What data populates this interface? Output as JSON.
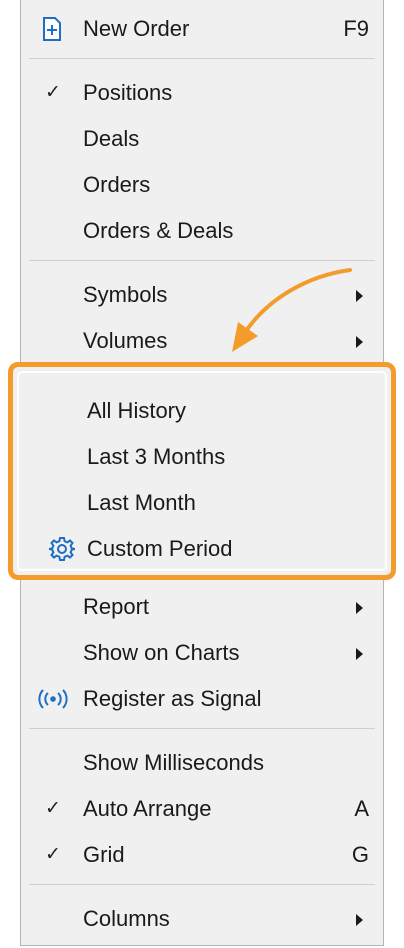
{
  "colors": {
    "highlight": "#f39c2c",
    "menu_bg": "#f0f0f0",
    "icon_blue": "#1e6fc4"
  },
  "menu": {
    "new_order": {
      "label": "New Order",
      "shortcut": "F9",
      "icon": "new-order-icon"
    },
    "positions": {
      "label": "Positions",
      "checked": true
    },
    "deals": {
      "label": "Deals"
    },
    "orders": {
      "label": "Orders"
    },
    "orders_deals": {
      "label": "Orders & Deals"
    },
    "symbols": {
      "label": "Symbols",
      "submenu": true
    },
    "volumes": {
      "label": "Volumes",
      "submenu": true
    },
    "all_history": {
      "label": "All History"
    },
    "last_3_months": {
      "label": "Last 3 Months"
    },
    "last_month": {
      "label": "Last Month"
    },
    "custom_period": {
      "label": "Custom Period",
      "icon": "gear-icon"
    },
    "report": {
      "label": "Report",
      "submenu": true
    },
    "show_on_charts": {
      "label": "Show on Charts",
      "submenu": true
    },
    "register_signal": {
      "label": "Register as Signal",
      "icon": "signal-broadcast-icon"
    },
    "show_ms": {
      "label": "Show Milliseconds"
    },
    "auto_arrange": {
      "label": "Auto Arrange",
      "shortcut": "A",
      "checked": true
    },
    "grid": {
      "label": "Grid",
      "shortcut": "G",
      "checked": true
    },
    "columns": {
      "label": "Columns",
      "submenu": true
    }
  },
  "check_glyph": "✓"
}
